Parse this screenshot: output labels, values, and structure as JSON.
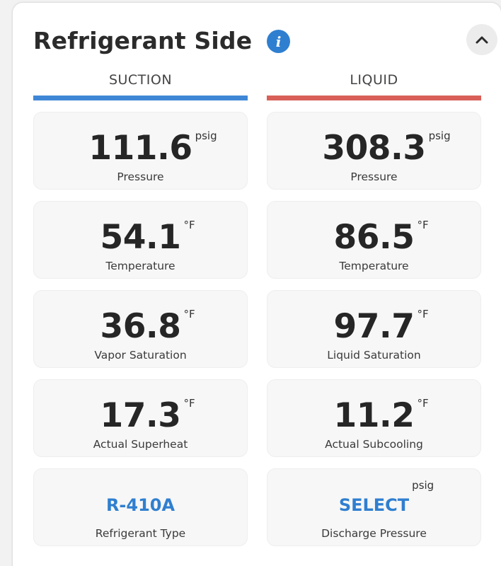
{
  "panel": {
    "title": "Refrigerant Side",
    "info_icon": "info-icon",
    "collapse_icon": "chevron-up-icon"
  },
  "colors": {
    "suction": "#3f87d6",
    "liquid": "#d96058",
    "link": "#2f7fd0"
  },
  "suction": {
    "heading": "SUCTION",
    "tiles": [
      {
        "value": "111.6",
        "unit": "psig",
        "label": "Pressure"
      },
      {
        "value": "54.1",
        "unit": "°F",
        "label": "Temperature"
      },
      {
        "value": "36.8",
        "unit": "°F",
        "label": "Vapor Saturation"
      },
      {
        "value": "17.3",
        "unit": "°F",
        "label": "Actual Superheat"
      },
      {
        "value": "R-410A",
        "unit": "",
        "label": "Refrigerant Type"
      }
    ]
  },
  "liquid": {
    "heading": "LIQUID",
    "tiles": [
      {
        "value": "308.3",
        "unit": "psig",
        "label": "Pressure"
      },
      {
        "value": "86.5",
        "unit": "°F",
        "label": "Temperature"
      },
      {
        "value": "97.7",
        "unit": "°F",
        "label": "Liquid Saturation"
      },
      {
        "value": "11.2",
        "unit": "°F",
        "label": "Actual Subcooling"
      },
      {
        "value": "SELECT",
        "unit": "psig",
        "label": "Discharge Pressure"
      }
    ]
  }
}
